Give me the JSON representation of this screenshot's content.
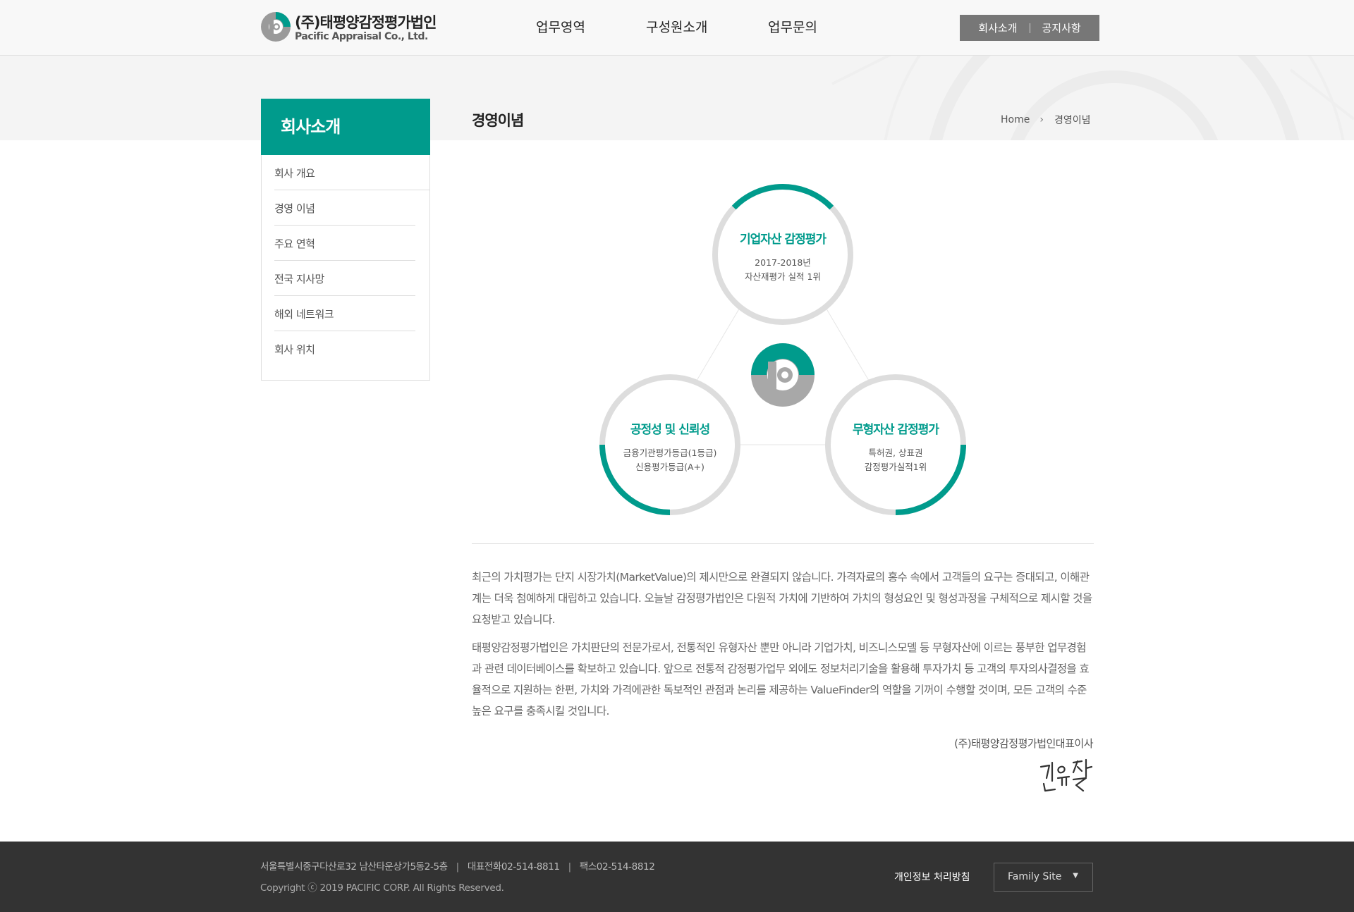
{
  "header": {
    "logo_ko": "(주)태평양감정평가법인",
    "logo_en": "Pacific Appraisal Co., Ltd.",
    "nav": [
      "업무영역",
      "구성원소개",
      "업무문의"
    ],
    "util": [
      "회사소개",
      "공지사항"
    ]
  },
  "lnb": {
    "title": "회사소개",
    "items": [
      "회사 개요",
      "경영 이념",
      "주요 연혁",
      "전국 지사망",
      "해외 네트워크",
      "회사 위치"
    ]
  },
  "content": {
    "title": "경영이념",
    "breadcrumb": [
      "Home",
      "경영이념"
    ],
    "circles": [
      {
        "title": "기업자산 감정평가",
        "desc": "2017-2018년\n자산재평가 실적 1위"
      },
      {
        "title": "공정성 및 신뢰성",
        "desc": "금융기관평가등급(1등급)\n신용평가등급(A+)"
      },
      {
        "title": "무형자산 감정평가",
        "desc": "특허권, 상표권\n감정평가실적1위"
      }
    ],
    "paragraphs": [
      "최근의 가치평가는 단지 시장가치(MarketValue)의 제시만으로 완결되지 않습니다. 가격자료의 홍수 속에서 고객들의 요구는 증대되고, 이해관계는 더욱 첨예하게 대립하고 있습니다. 오늘날 감정평가법인은 다원적 가치에 기반하여 가치의 형성요인 및 형성과정을 구체적으로 제시할 것을 요청받고 있습니다.",
      "태평양감정평가법인은 가치판단의 전문가로서, 전통적인 유형자산 뿐만 아니라 기업가치, 비즈니스모델 등 무형자산에 이르는 풍부한 업무경험과 관련 데이터베이스를 확보하고 있습니다. 앞으로 전통적 감정평가업무 외에도 정보처리기술을 활용해 투자가치 등 고객의 투자의사결정을 효율적으로 지원하는 한편, 가치와 가격에관한 독보적인 관점과 논리를 제공하는 ValueFinder의 역할을 기꺼이 수행할 것이며, 모든 고객의 수준 높은 요구를 충족시킬 것입니다."
    ],
    "ceo": "(주)태평양감정평가법인대표이사",
    "signature": "김윤철"
  },
  "footer": {
    "address": "서울특별시중구다산로32 남산타운상가5동2-5층",
    "phone": "대표전화02-514-8811",
    "fax": "팩스02-514-8812",
    "copyright": "Copyright ⓒ 2019 PACIFIC CORP. All Rights Reserved.",
    "privacy": "개인정보 처리방침",
    "family_site": "Family Site"
  },
  "colors": {
    "accent": "#009b8c",
    "ring": "#dddddd",
    "footer_bg": "#333333"
  }
}
